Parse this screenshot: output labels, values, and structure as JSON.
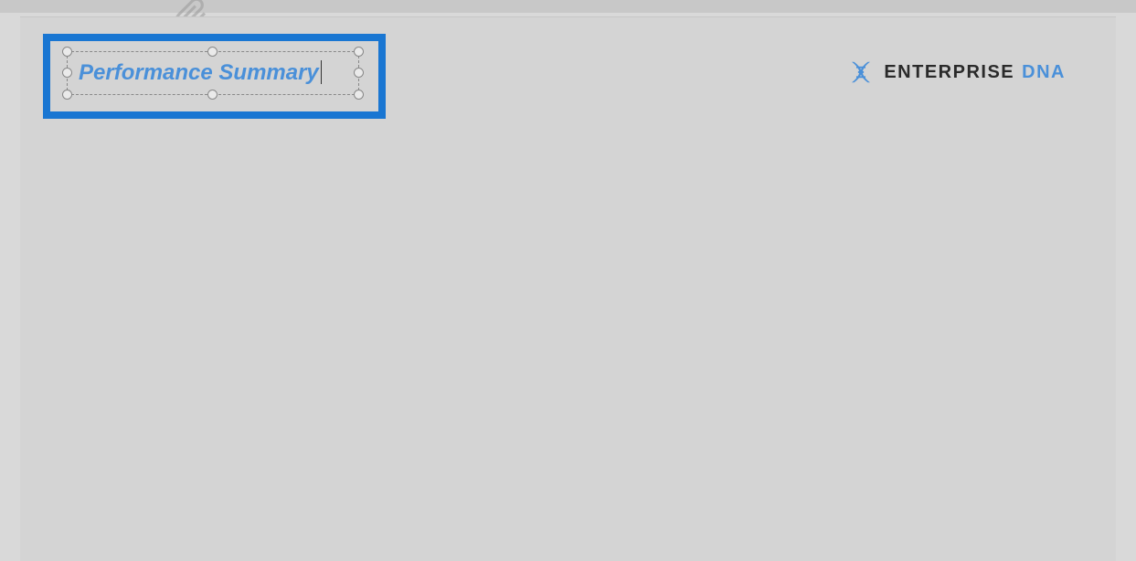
{
  "textbox": {
    "title_text": "Performance Summary"
  },
  "logo": {
    "word1": "ENTERPRISE",
    "word2": "DNA"
  }
}
